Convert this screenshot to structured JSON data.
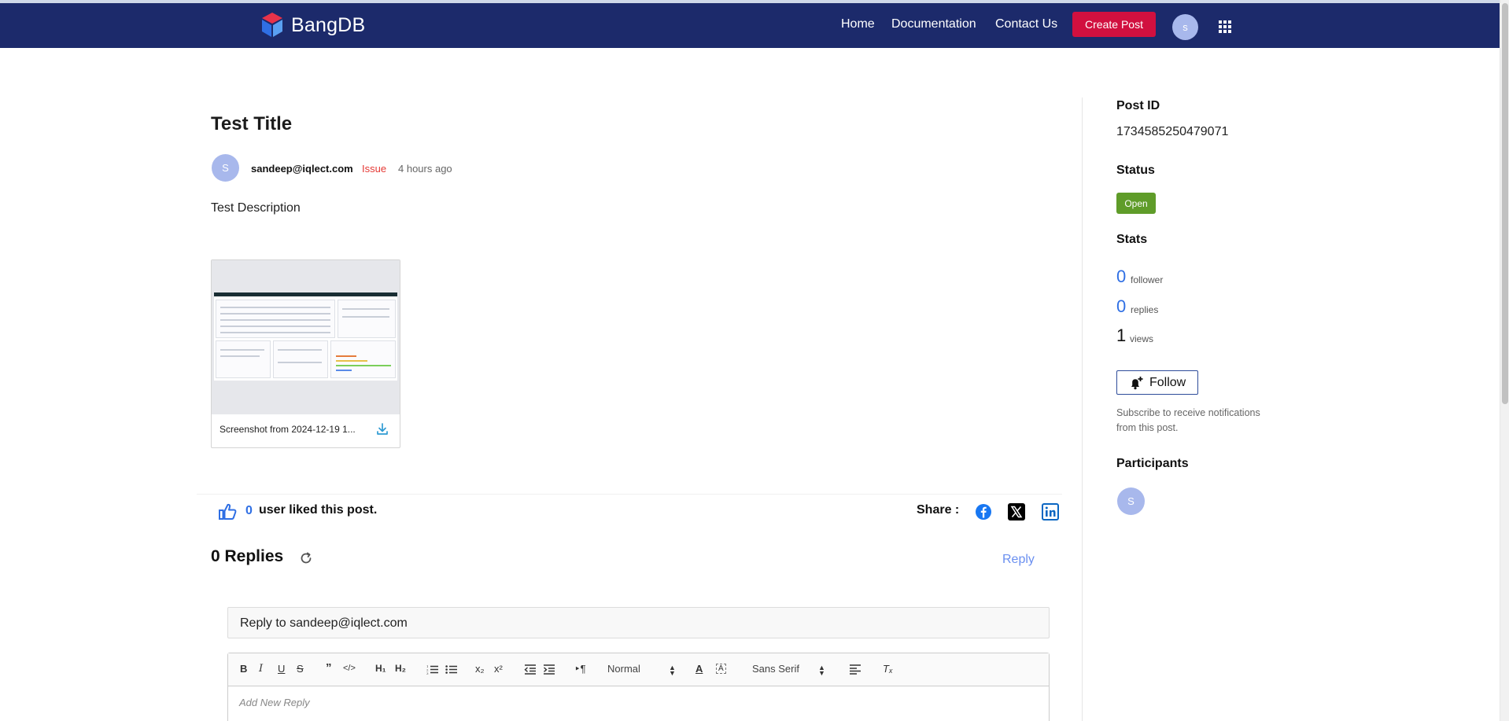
{
  "navbar": {
    "brand": "BangDB",
    "links": [
      "Home",
      "Documentation",
      "Contact Us"
    ],
    "create_post": "Create Post",
    "avatar_initial": "s",
    "apps_icon": "apps-grid-icon"
  },
  "post": {
    "title": "Test Title",
    "author_initial": "S",
    "author": "sandeep@iqlect.com",
    "type": "Issue",
    "time": "4 hours ago",
    "description": "Test Description",
    "attachment": {
      "name": "Screenshot from 2024-12-19 1...",
      "download_icon": "download-icon"
    }
  },
  "likes": {
    "count": "0",
    "text": "user liked this post.",
    "icon": "thumbs-up-icon"
  },
  "share": {
    "label": "Share :",
    "icons": [
      "facebook-icon",
      "x-icon",
      "linkedin-icon"
    ]
  },
  "replies": {
    "title": "0 Replies",
    "reply_link": "Reply",
    "reply_to": "Reply to sandeep@iqlect.com"
  },
  "editor": {
    "heading_select": "Normal",
    "font_select": "Sans Serif",
    "placeholder": "Add New Reply"
  },
  "sidebar": {
    "post_id_label": "Post ID",
    "post_id": "1734585250479071",
    "status_label": "Status",
    "status": "Open",
    "stats_label": "Stats",
    "followers": "0",
    "followers_label": "follower",
    "replies": "0",
    "replies_label": "replies",
    "views": "1",
    "views_label": "views",
    "follow_button": "Follow",
    "subscribe_text": "Subscribe to receive notifications from this post.",
    "participants_label": "Participants",
    "participant_initial": "S"
  },
  "colors": {
    "navbar": "#1c2a6b",
    "create_button": "#d1103f",
    "status_open": "#5f9c29",
    "issue": "#e53935",
    "link_blue": "#2f6fe4"
  }
}
